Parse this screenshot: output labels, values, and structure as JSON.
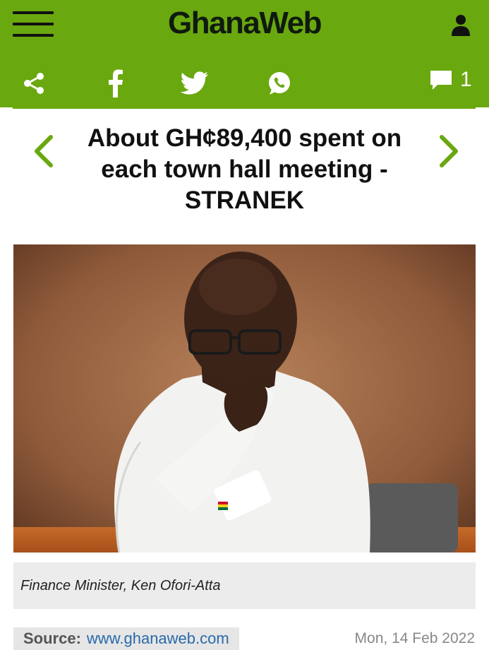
{
  "header": {
    "logo_text": "GhanaWeb",
    "menu_icon": "hamburger-menu-icon",
    "user_icon": "user-icon",
    "brand_color": "#6aa80f"
  },
  "share_bar": {
    "icons": [
      "share-icon",
      "facebook-icon",
      "twitter-icon",
      "whatsapp-icon"
    ],
    "comments_count": "1"
  },
  "article": {
    "headline": "About GH¢89,400 spent on each town hall meeting - STRANEK",
    "image_caption": "Finance Minister, Ken Ofori-Atta",
    "source_label": "Source:",
    "source_link": "www.ghanaweb.com",
    "date": "Mon, 14 Feb 2022"
  }
}
